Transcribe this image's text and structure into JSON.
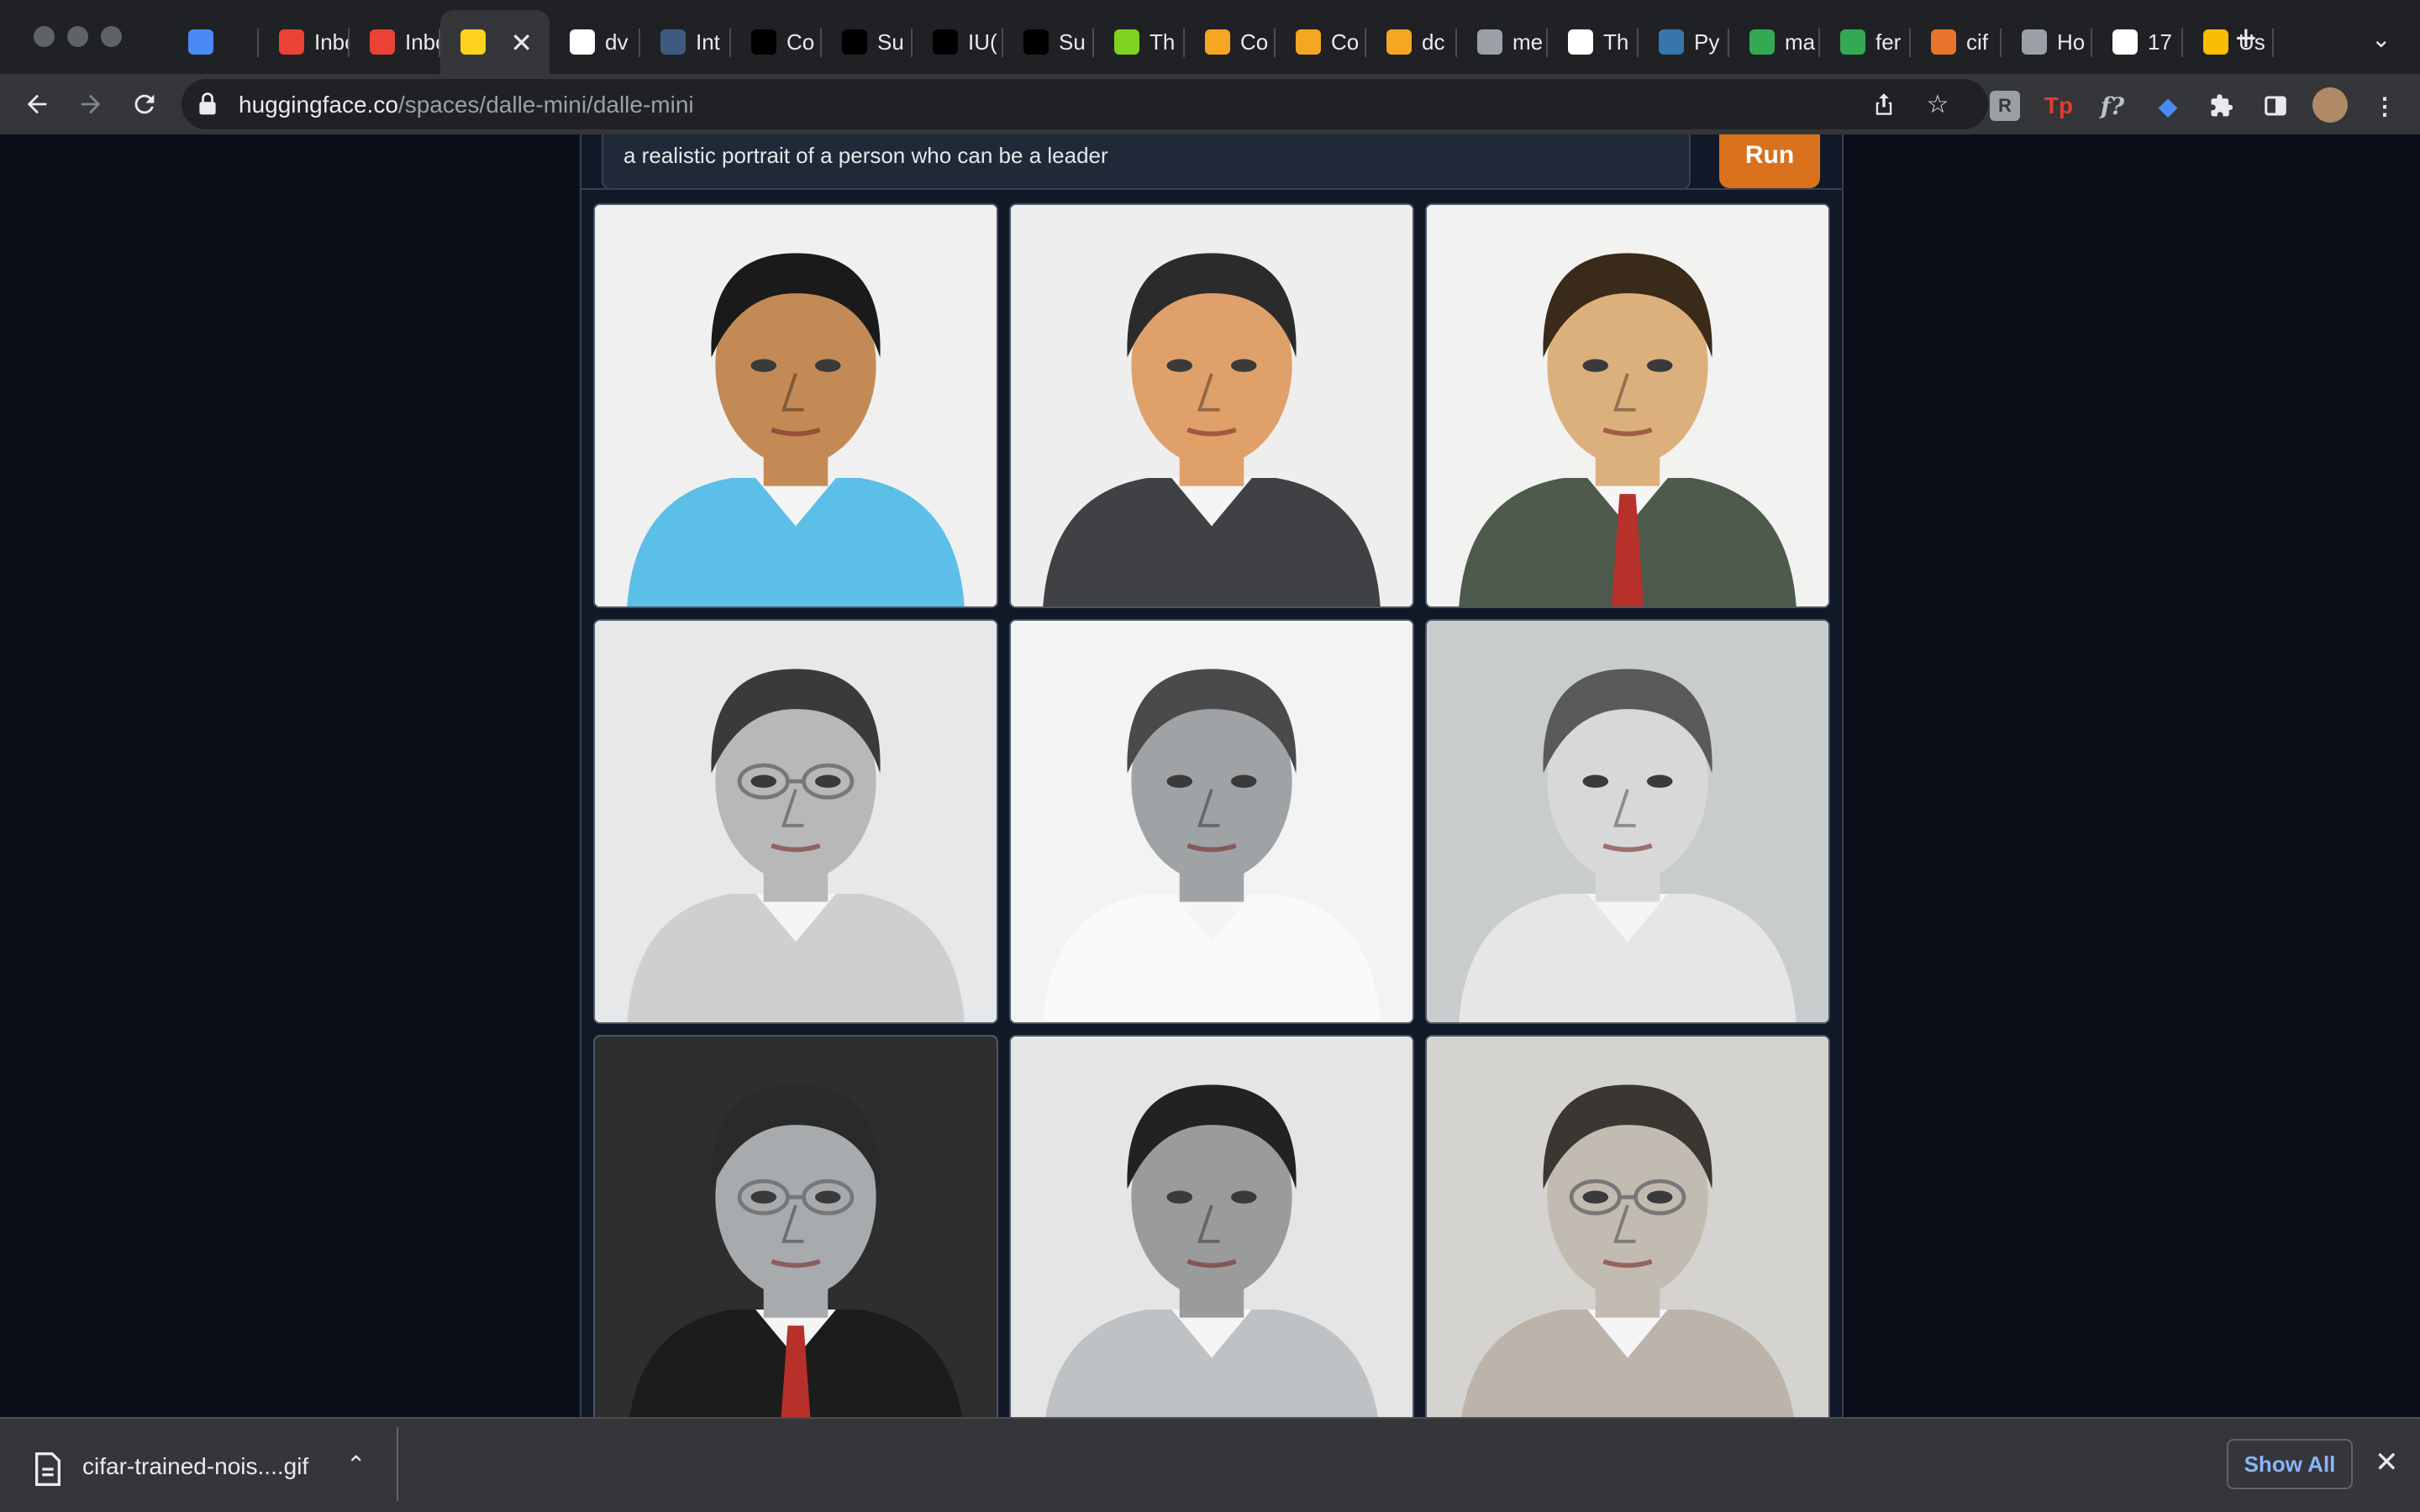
{
  "browser": {
    "tabs": [
      {
        "label": "",
        "favicon": "gem-icon",
        "color": "#4a8af4"
      },
      {
        "label": "Inbox",
        "favicon": "gmail-icon",
        "color": "#ea4335"
      },
      {
        "label": "Inbox",
        "favicon": "gmail-icon",
        "color": "#ea4335"
      },
      {
        "label": "",
        "favicon": "huggingface-icon",
        "color": "#ffd21e",
        "active": true
      },
      {
        "label": "dv",
        "favicon": "github-icon",
        "color": "#ffffff"
      },
      {
        "label": "Int",
        "favicon": "tds-icon",
        "color": "#3d5a80"
      },
      {
        "label": "Co",
        "favicon": "dots-icon",
        "color": "#000000"
      },
      {
        "label": "Su",
        "favicon": "dots-icon",
        "color": "#000000"
      },
      {
        "label": "IU(",
        "favicon": "dots-icon",
        "color": "#000000"
      },
      {
        "label": "Su",
        "favicon": "dots-icon",
        "color": "#000000"
      },
      {
        "label": "Th",
        "favicon": "smiley-icon",
        "color": "#7ed321"
      },
      {
        "label": "Co",
        "favicon": "infinity-icon",
        "color": "#f5a623"
      },
      {
        "label": "Co",
        "favicon": "infinity-icon",
        "color": "#f5a623"
      },
      {
        "label": "dc",
        "favicon": "infinity-icon",
        "color": "#f5a623"
      },
      {
        "label": "me",
        "favicon": "infinity-icon",
        "color": "#9aa0a6"
      },
      {
        "label": "Th",
        "favicon": "grid-icon",
        "color": "#ffffff"
      },
      {
        "label": "Py",
        "favicon": "python-icon",
        "color": "#3776ab"
      },
      {
        "label": "ma",
        "favicon": "drive-icon",
        "color": "#34a853"
      },
      {
        "label": "fer",
        "favicon": "drive-icon",
        "color": "#34a853"
      },
      {
        "label": "cif",
        "favicon": "circle-icon",
        "color": "#e8742c"
      },
      {
        "label": "Ho",
        "favicon": "doc-icon",
        "color": "#9aa0a6"
      },
      {
        "label": "17",
        "favicon": "hp-icon",
        "color": "#ffffff"
      },
      {
        "label": "Us",
        "favicon": "star-icon",
        "color": "#fbbc04"
      }
    ],
    "url_host": "huggingface.co",
    "url_path": "/spaces/dalle-mini/dalle-mini"
  },
  "app": {
    "prompt_text": "a realistic portrait of a person who can be a leader",
    "run_label": "Run",
    "images": [
      {
        "name": "generated-image-1",
        "bg": "#f0f0f0",
        "skin": "#c48a55",
        "hair": "#1a1a1a",
        "shirt": "#5bbfe8",
        "glasses": false,
        "tie": false
      },
      {
        "name": "generated-image-2",
        "bg": "#eeeeee",
        "skin": "#e0a06a",
        "hair": "#2b2b2b",
        "shirt": "#3f4144",
        "glasses": false,
        "tie": false
      },
      {
        "name": "generated-image-3",
        "bg": "#f2f2f0",
        "skin": "#dcb07c",
        "hair": "#3a2a1a",
        "shirt": "#4d5a4c",
        "glasses": false,
        "tie": true
      },
      {
        "name": "generated-image-4",
        "bg": "#e7e8ea",
        "skin": "#b8b8b8",
        "hair": "#3a3a3a",
        "shirt": "#cfcfcf",
        "glasses": true,
        "tie": false
      },
      {
        "name": "generated-image-5",
        "bg": "#f3f3f3",
        "skin": "#9fa3a6",
        "hair": "#4a4a4a",
        "shirt": "#fafafa",
        "glasses": false,
        "tie": false
      },
      {
        "name": "generated-image-6",
        "bg": "#c9cccc",
        "skin": "#d8d8d8",
        "hair": "#5a5a5a",
        "shirt": "#e6e6e6",
        "glasses": false,
        "tie": false
      },
      {
        "name": "generated-image-7",
        "bg": "#2e2e2e",
        "skin": "#a7abae",
        "hair": "#2a2a2a",
        "shirt": "#1c1c1c",
        "glasses": true,
        "tie": true
      },
      {
        "name": "generated-image-8",
        "bg": "#e5e5e5",
        "skin": "#9a9c9c",
        "hair": "#222222",
        "shirt": "#bfc2c4",
        "glasses": false,
        "tie": false
      },
      {
        "name": "generated-image-9",
        "bg": "#d5d3cf",
        "skin": "#c2bbb2",
        "hair": "#3a3632",
        "shirt": "#bcb4aa",
        "glasses": true,
        "tie": false
      }
    ]
  },
  "download": {
    "filename": "cifar-trained-nois....gif",
    "show_all_label": "Show All"
  }
}
